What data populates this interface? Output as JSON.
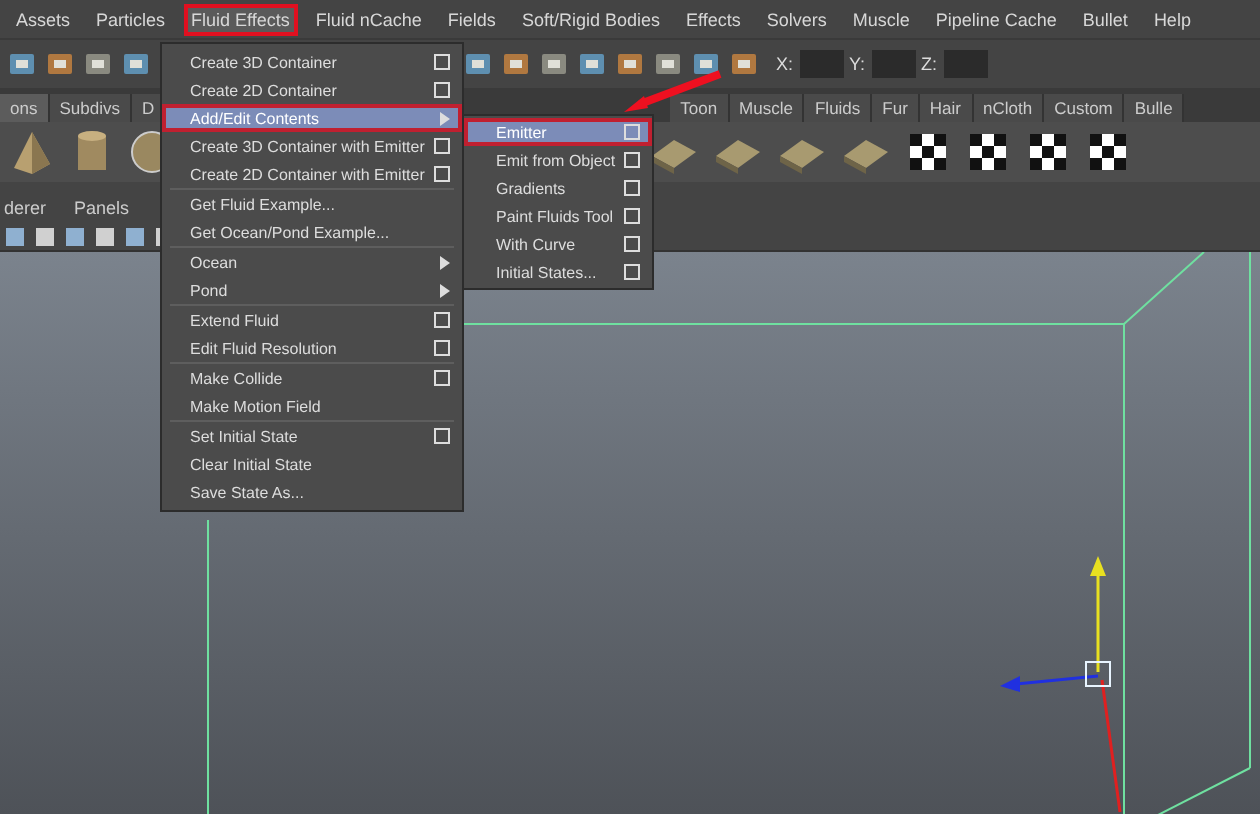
{
  "menu_bar": [
    {
      "label": "Assets",
      "selected": false,
      "annotated": false
    },
    {
      "label": "Particles",
      "selected": false,
      "annotated": false
    },
    {
      "label": "Fluid Effects",
      "selected": true,
      "annotated": true
    },
    {
      "label": "Fluid nCache",
      "selected": false,
      "annotated": false
    },
    {
      "label": "Fields",
      "selected": false,
      "annotated": false
    },
    {
      "label": "Soft/Rigid Bodies",
      "selected": false,
      "annotated": false
    },
    {
      "label": "Effects",
      "selected": false,
      "annotated": false
    },
    {
      "label": "Solvers",
      "selected": false,
      "annotated": false
    },
    {
      "label": "Muscle",
      "selected": false,
      "annotated": false
    },
    {
      "label": "Pipeline Cache",
      "selected": false,
      "annotated": false
    },
    {
      "label": "Bullet",
      "selected": false,
      "annotated": false
    },
    {
      "label": "Help",
      "selected": false,
      "annotated": false
    }
  ],
  "coordinate_fields": [
    {
      "label": "X:"
    },
    {
      "label": "Y:"
    },
    {
      "label": "Z:"
    }
  ],
  "shelf_tabs": [
    {
      "label": "ons",
      "selected": true
    },
    {
      "label": "Subdivs",
      "selected": false
    },
    {
      "label": "D",
      "selected": false
    },
    {
      "label": "Toon",
      "selected": false
    },
    {
      "label": "Muscle",
      "selected": false
    },
    {
      "label": "Fluids",
      "selected": false
    },
    {
      "label": "Fur",
      "selected": false
    },
    {
      "label": "Hair",
      "selected": false
    },
    {
      "label": "nCloth",
      "selected": false
    },
    {
      "label": "Custom",
      "selected": false
    },
    {
      "label": "Bulle",
      "selected": false
    }
  ],
  "panel_menu": [
    "derer",
    "Panels"
  ],
  "dropdown": {
    "items": [
      {
        "label": "Create 3D Container",
        "kind": "item",
        "option_box": true,
        "selected": false,
        "annotated": false,
        "separator_after": false
      },
      {
        "label": "Create 2D Container",
        "kind": "item",
        "option_box": true,
        "selected": false,
        "annotated": false,
        "separator_after": false
      },
      {
        "label": "Add/Edit Contents",
        "kind": "submenu",
        "option_box": false,
        "selected": true,
        "annotated": true,
        "separator_after": false
      },
      {
        "label": "Create 3D Container with Emitter",
        "kind": "item",
        "option_box": true,
        "selected": false,
        "annotated": false,
        "separator_after": false
      },
      {
        "label": "Create 2D Container with Emitter",
        "kind": "item",
        "option_box": true,
        "selected": false,
        "annotated": false,
        "separator_after": true
      },
      {
        "label": "Get Fluid Example...",
        "kind": "item",
        "option_box": false,
        "selected": false,
        "annotated": false,
        "separator_after": false
      },
      {
        "label": "Get Ocean/Pond Example...",
        "kind": "item",
        "option_box": false,
        "selected": false,
        "annotated": false,
        "separator_after": true
      },
      {
        "label": "Ocean",
        "kind": "submenu",
        "option_box": false,
        "selected": false,
        "annotated": false,
        "separator_after": false
      },
      {
        "label": "Pond",
        "kind": "submenu",
        "option_box": false,
        "selected": false,
        "annotated": false,
        "separator_after": true
      },
      {
        "label": "Extend Fluid",
        "kind": "item",
        "option_box": true,
        "selected": false,
        "annotated": false,
        "separator_after": false
      },
      {
        "label": "Edit Fluid Resolution",
        "kind": "item",
        "option_box": true,
        "selected": false,
        "annotated": false,
        "separator_after": true
      },
      {
        "label": "Make Collide",
        "kind": "item",
        "option_box": true,
        "selected": false,
        "annotated": false,
        "separator_after": false
      },
      {
        "label": "Make Motion Field",
        "kind": "item",
        "option_box": false,
        "selected": false,
        "annotated": false,
        "separator_after": true
      },
      {
        "label": "Set Initial State",
        "kind": "item",
        "option_box": true,
        "selected": false,
        "annotated": false,
        "separator_after": false
      },
      {
        "label": "Clear Initial State",
        "kind": "item",
        "option_box": false,
        "selected": false,
        "annotated": false,
        "separator_after": false
      },
      {
        "label": "Save State As...",
        "kind": "item",
        "option_box": false,
        "selected": false,
        "annotated": false,
        "separator_after": false
      }
    ]
  },
  "submenu": {
    "items": [
      {
        "label": "Emitter",
        "option_box": true,
        "selected": true,
        "annotated": true
      },
      {
        "label": "Emit from Object",
        "option_box": true,
        "selected": false,
        "annotated": false
      },
      {
        "label": "Gradients",
        "option_box": true,
        "selected": false,
        "annotated": false
      },
      {
        "label": "Paint Fluids Tool",
        "option_box": true,
        "selected": false,
        "annotated": false
      },
      {
        "label": "With Curve",
        "option_box": true,
        "selected": false,
        "annotated": false
      },
      {
        "label": "Initial States...",
        "option_box": true,
        "selected": false,
        "annotated": false
      }
    ]
  }
}
